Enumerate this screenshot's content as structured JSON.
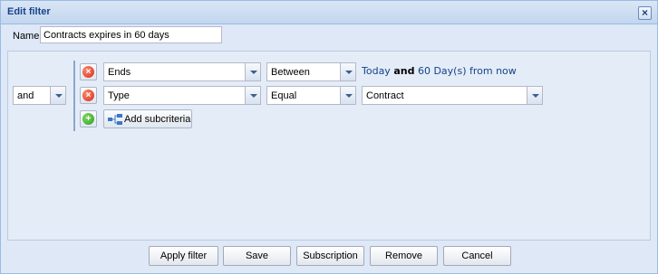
{
  "dialog": {
    "title": "Edit filter",
    "close_icon": "close-icon"
  },
  "name": {
    "label": "Name:",
    "value": "Contracts expires in 60 days"
  },
  "logic": {
    "operator": "and"
  },
  "criteria": [
    {
      "remove_icon": "remove-icon",
      "field": "Ends",
      "operator": "Between",
      "value_parts": {
        "start": "Today",
        "joiner": "and",
        "end": "60 Day(s) from now"
      }
    },
    {
      "remove_icon": "remove-icon",
      "field": "Type",
      "operator": "Equal",
      "value": "Contract"
    }
  ],
  "add": {
    "add_icon": "add-icon",
    "subcriteria_icon": "subcriteria-icon",
    "subcriteria_label": "Add subcriteria"
  },
  "footer": {
    "apply_label": "Apply filter",
    "save_label": "Save",
    "subscription_label": "Subscription",
    "remove_label": "Remove",
    "cancel_label": "Cancel"
  },
  "colors": {
    "title": "#15428b",
    "panel": "#dfe8f6",
    "border": "#99bbe8"
  }
}
